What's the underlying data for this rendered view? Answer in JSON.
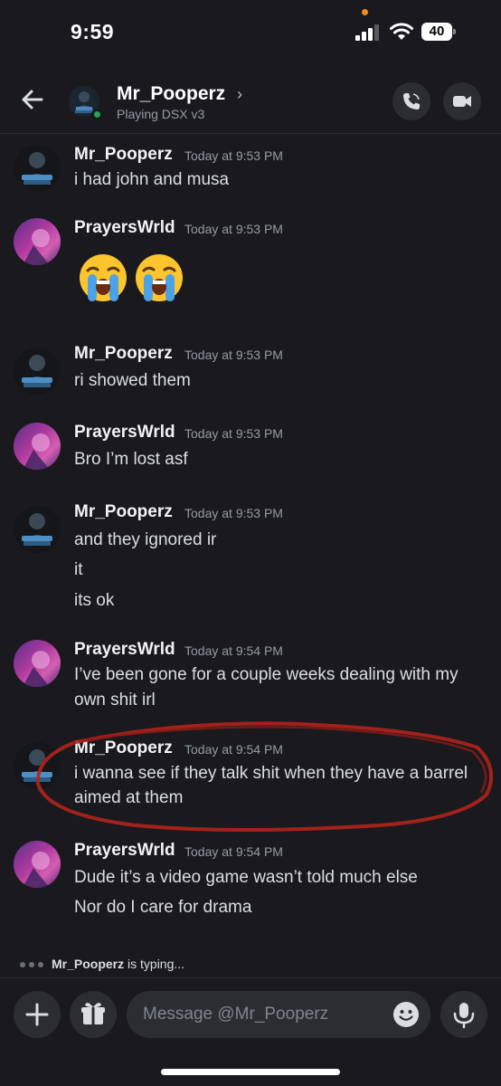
{
  "status_bar": {
    "time": "9:59",
    "battery": "40"
  },
  "header": {
    "name": "Mr_Pooperz",
    "chevron": "›",
    "status": "Playing DSX v3"
  },
  "messages": [
    {
      "user": "Mr_Pooperz",
      "time": "Today at 9:53 PM",
      "lines": [
        "i had john and musa"
      ]
    },
    {
      "user": "PrayersWrld",
      "time": "Today at 9:53 PM",
      "lines": [],
      "emoji": [
        "loudly-crying-face",
        "loudly-crying-face"
      ]
    },
    {
      "user": "Mr_Pooperz",
      "time": "Today at 9:53 PM",
      "lines": [
        "ri showed them"
      ]
    },
    {
      "user": "PrayersWrld",
      "time": "Today at 9:53 PM",
      "lines": [
        "Bro I’m lost asf"
      ]
    },
    {
      "user": "Mr_Pooperz",
      "time": "Today at 9:53 PM",
      "lines": [
        "and they ignored ir",
        "it",
        "its ok"
      ]
    },
    {
      "user": "PrayersWrld",
      "time": "Today at 9:54 PM",
      "lines": [
        "I’ve been gone for a couple weeks dealing with my",
        "own shit irl"
      ]
    },
    {
      "user": "Mr_Pooperz",
      "time": "Today at 9:54 PM",
      "lines": [
        "i wanna see if they talk shit when they have a barrel",
        "aimed at them"
      ]
    },
    {
      "user": "PrayersWrld",
      "time": "Today at 9:54 PM",
      "lines": [
        "Dude it’s a video game wasn’t told much else",
        "Nor do I care for drama"
      ]
    }
  ],
  "typing": {
    "user": "Mr_Pooperz",
    "text": "is typing..."
  },
  "composer": {
    "placeholder": "Message @Mr_Pooperz"
  },
  "colors": {
    "background": "#1a1a1e",
    "online": "#23a55a",
    "annotation_circle": "#b3221c"
  }
}
